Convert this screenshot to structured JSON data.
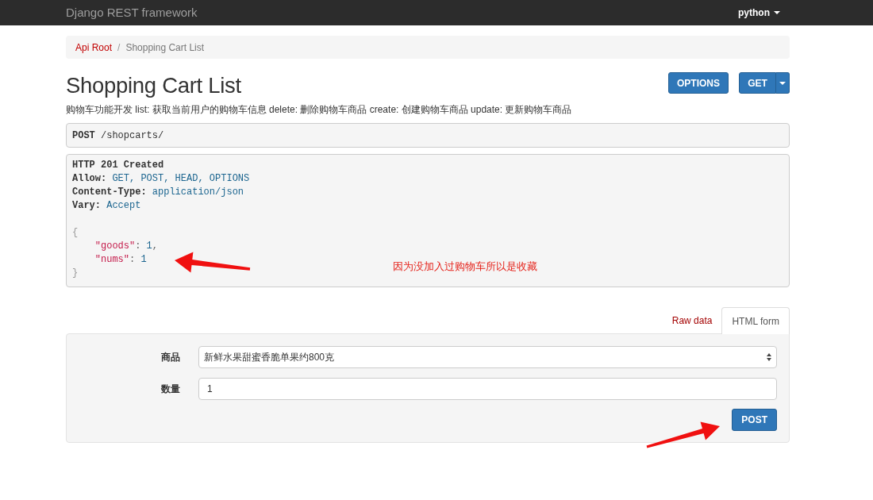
{
  "navbar": {
    "brand": "Django REST framework",
    "user_menu": "python"
  },
  "breadcrumb": {
    "items": [
      {
        "label": "Api Root",
        "active": false
      },
      {
        "label": "Shopping Cart List",
        "active": true
      }
    ],
    "separator": "/"
  },
  "page": {
    "title": "Shopping Cart List",
    "description": "购物车功能开发 list: 获取当前用户的购物车信息 delete: 删除购物车商品 create: 创建购物车商品 update: 更新购物车商品"
  },
  "header_buttons": [
    {
      "label": "OPTIONS",
      "kind": "button"
    },
    {
      "label": "GET",
      "kind": "split"
    }
  ],
  "request": {
    "method": "POST",
    "path": "/shopcarts/"
  },
  "response": {
    "status": "HTTP 201 Created",
    "headers": [
      {
        "name": "Allow:",
        "value": "GET, POST, HEAD, OPTIONS"
      },
      {
        "name": "Content-Type:",
        "value": "application/json"
      },
      {
        "name": "Vary:",
        "value": "Accept"
      }
    ],
    "body": {
      "open": "{",
      "members": [
        {
          "key": "\"goods\"",
          "colon": ":",
          "value": "1",
          "comma": ","
        },
        {
          "key": "\"nums\"",
          "colon": ":",
          "value": "1"
        }
      ],
      "close": "}"
    }
  },
  "annotation": {
    "note": "因为没加入过购物车所以是收藏"
  },
  "tabs": [
    {
      "label": "Raw data",
      "selected": false
    },
    {
      "label": "HTML form",
      "selected": true
    }
  ],
  "form": {
    "fields": [
      {
        "label": "商品",
        "kind": "select",
        "value": "新鲜水果甜蜜香脆单果约800克"
      },
      {
        "label": "数量",
        "kind": "text",
        "value": "1"
      }
    ],
    "submit": "POST"
  }
}
